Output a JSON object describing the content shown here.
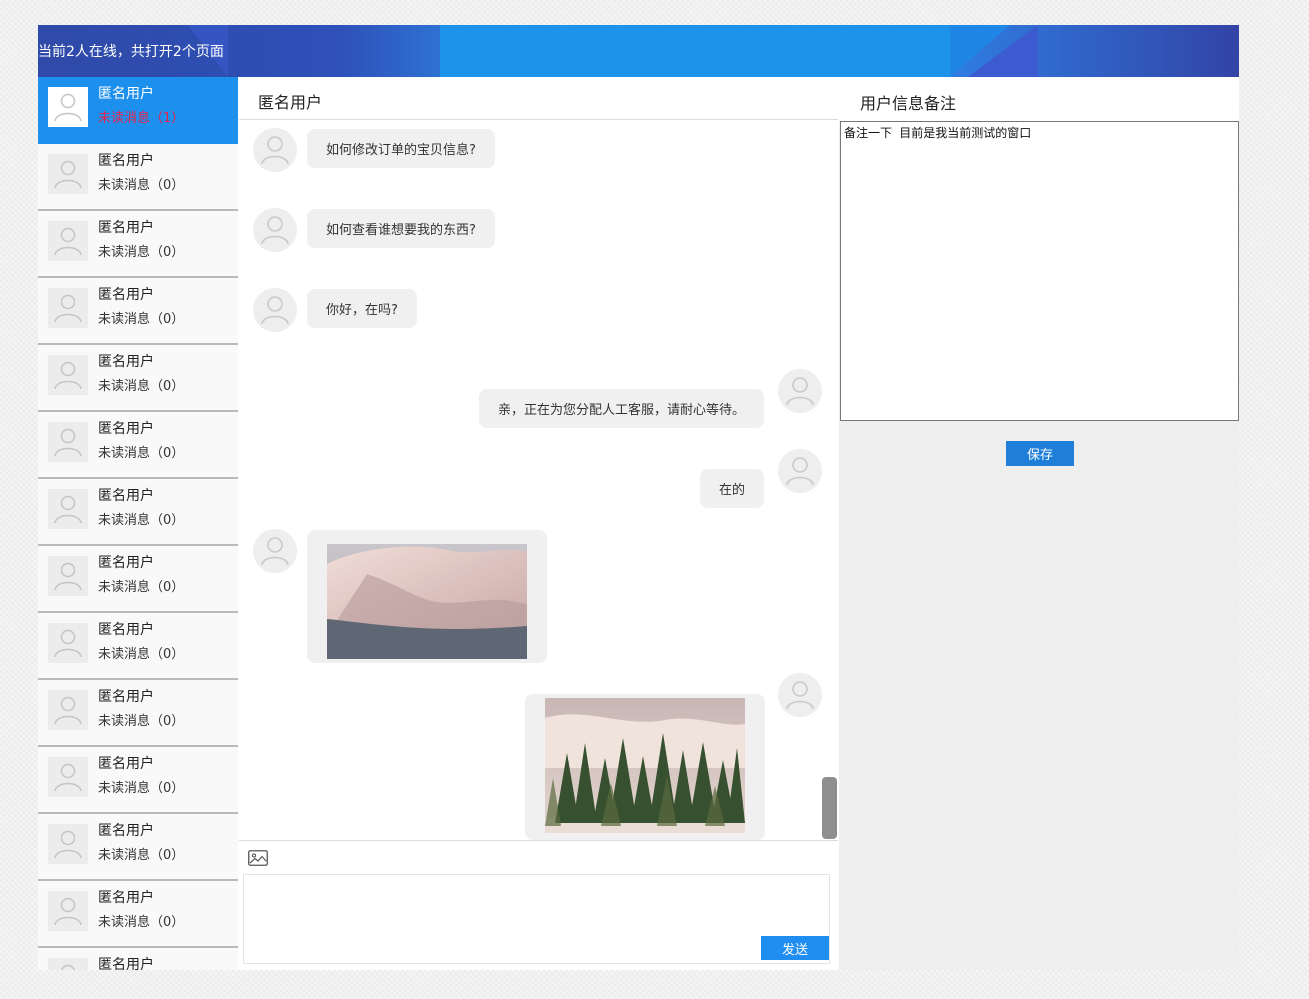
{
  "header": {
    "title": "当前2人在线，共打开2个页面"
  },
  "sidebar": {
    "items": [
      {
        "name": "匿名用户",
        "unread": "未读消息（1）",
        "active": true
      },
      {
        "name": "匿名用户",
        "unread": "未读消息（0）"
      },
      {
        "name": "匿名用户",
        "unread": "未读消息（0）"
      },
      {
        "name": "匿名用户",
        "unread": "未读消息（0）"
      },
      {
        "name": "匿名用户",
        "unread": "未读消息（0）"
      },
      {
        "name": "匿名用户",
        "unread": "未读消息（0）"
      },
      {
        "name": "匿名用户",
        "unread": "未读消息（0）"
      },
      {
        "name": "匿名用户",
        "unread": "未读消息（0）"
      },
      {
        "name": "匿名用户",
        "unread": "未读消息（0）"
      },
      {
        "name": "匿名用户",
        "unread": "未读消息（0）"
      },
      {
        "name": "匿名用户",
        "unread": "未读消息（0）"
      },
      {
        "name": "匿名用户",
        "unread": "未读消息（0）"
      },
      {
        "name": "匿名用户",
        "unread": "未读消息（0）"
      },
      {
        "name": "匿名用户",
        "unread": ""
      }
    ]
  },
  "chat": {
    "title": "匿名用户",
    "messages": [
      {
        "side": "left",
        "type": "text",
        "text": "如何修改订单的宝贝信息?"
      },
      {
        "side": "left",
        "type": "text",
        "text": "如何查看谁想要我的东西?"
      },
      {
        "side": "left",
        "type": "text",
        "text": "你好，在吗?"
      },
      {
        "side": "right",
        "type": "text",
        "text": "亲，正在为您分配人工客服，请耐心等待。"
      },
      {
        "side": "right",
        "type": "text",
        "text": "在的"
      },
      {
        "side": "left",
        "type": "image",
        "image": "snow-dune-photo"
      },
      {
        "side": "right",
        "type": "image",
        "image": "pine-trees-snow-photo"
      }
    ],
    "send_label": "发送",
    "image_tool_icon": "image-upload-icon"
  },
  "notes": {
    "title": "用户信息备注",
    "text": "备注一下 目前是我当前测试的窗口",
    "save_label": "保存"
  },
  "colors": {
    "header_blue": "#2196ef",
    "active_item": "#1d8fec",
    "unread_active": "#e2264d",
    "button_blue": "#1f8ef0"
  }
}
